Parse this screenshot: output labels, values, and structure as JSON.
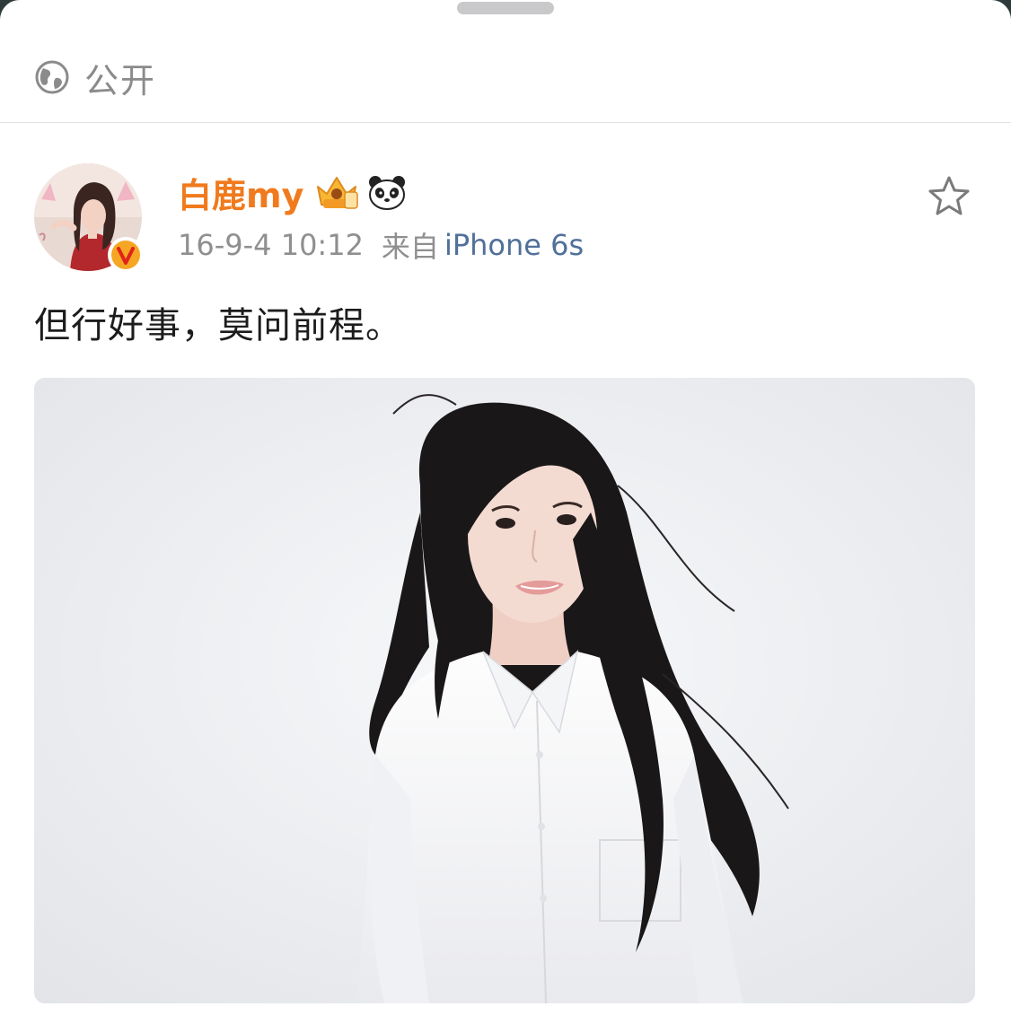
{
  "sheet": {
    "visibility_label": "公开"
  },
  "post": {
    "author_name": "白鹿my",
    "timestamp": "16-9-4 10:12",
    "source_prefix": "来自",
    "source_device": "iPhone 6s",
    "text": "但行好事，莫问前程。",
    "image": "portrait photo of woman with long black hair in white shirt"
  },
  "icons": {
    "visibility": "globe-icon",
    "verified": "verified-v-badge-icon",
    "vip": "vip-crown-badge-icon",
    "emoji": "panda-emoji-icon",
    "favorite": "star-outline-icon"
  },
  "colors": {
    "author_name": "#f07a1d",
    "source_device": "#51709a",
    "meta_text": "#8f8f8f",
    "verified_badge": "#f5a623"
  }
}
